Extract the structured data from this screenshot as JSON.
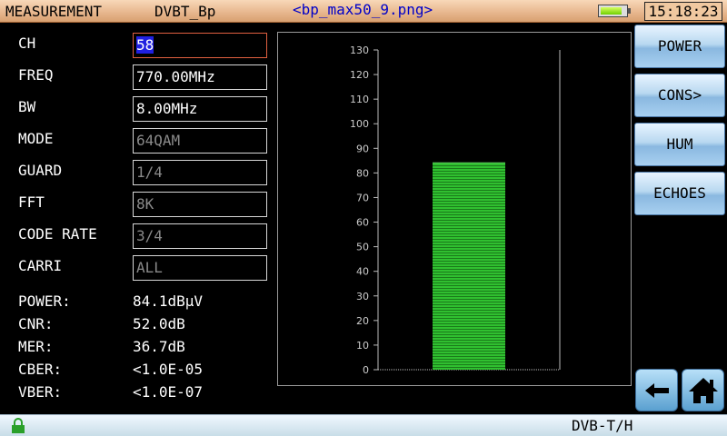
{
  "header": {
    "title": "MEASUREMENT",
    "standard": "DVBT_Bp",
    "filename": "<bp_max50_9.png>",
    "battery_icon": "battery-icon",
    "battery_level": 0.8,
    "time": "15:18:23"
  },
  "params": [
    {
      "label": "CH",
      "value": "58",
      "editable": true,
      "active": true
    },
    {
      "label": "FREQ",
      "value": "770.00MHz",
      "editable": true,
      "active": false
    },
    {
      "label": "BW",
      "value": "8.00MHz",
      "editable": true,
      "active": false
    },
    {
      "label": "MODE",
      "value": "64QAM",
      "editable": false,
      "active": false
    },
    {
      "label": "GUARD",
      "value": "1/4",
      "editable": false,
      "active": false
    },
    {
      "label": "FFT",
      "value": "8K",
      "editable": false,
      "active": false
    },
    {
      "label": "CODE RATE",
      "value": "3/4",
      "editable": false,
      "active": false
    },
    {
      "label": "CARRI",
      "value": "ALL",
      "editable": false,
      "active": false
    }
  ],
  "measurements": [
    {
      "label": "POWER:",
      "value": "84.1dBµV"
    },
    {
      "label": "CNR:",
      "value": "52.0dB"
    },
    {
      "label": "MER:",
      "value": "36.7dB"
    },
    {
      "label": "CBER:",
      "value": "<1.0E-05"
    },
    {
      "label": "VBER:",
      "value": "<1.0E-07"
    }
  ],
  "side_buttons": [
    {
      "label": "POWER"
    },
    {
      "label": "CONS>"
    },
    {
      "label": "HUM"
    },
    {
      "label": "ECHOES"
    }
  ],
  "nav": {
    "back_icon": "back-arrow-icon",
    "home_icon": "home-icon"
  },
  "footer": {
    "mode": "DVB-T/H",
    "lock_icon": "lock-icon",
    "lock_color": "#2aa02a"
  },
  "colors": {
    "bar": "#30c030",
    "selection": "#2020e0",
    "active_border": "#e06040"
  },
  "chart_data": {
    "type": "bar",
    "categories": [
      ""
    ],
    "values": [
      84.1
    ],
    "ylim": [
      0,
      130
    ],
    "yticks": [
      "0",
      "10",
      "20",
      "30",
      "40",
      "50",
      "60",
      "70",
      "80",
      "90",
      "100",
      "110",
      "120",
      "130"
    ],
    "grid": false
  }
}
